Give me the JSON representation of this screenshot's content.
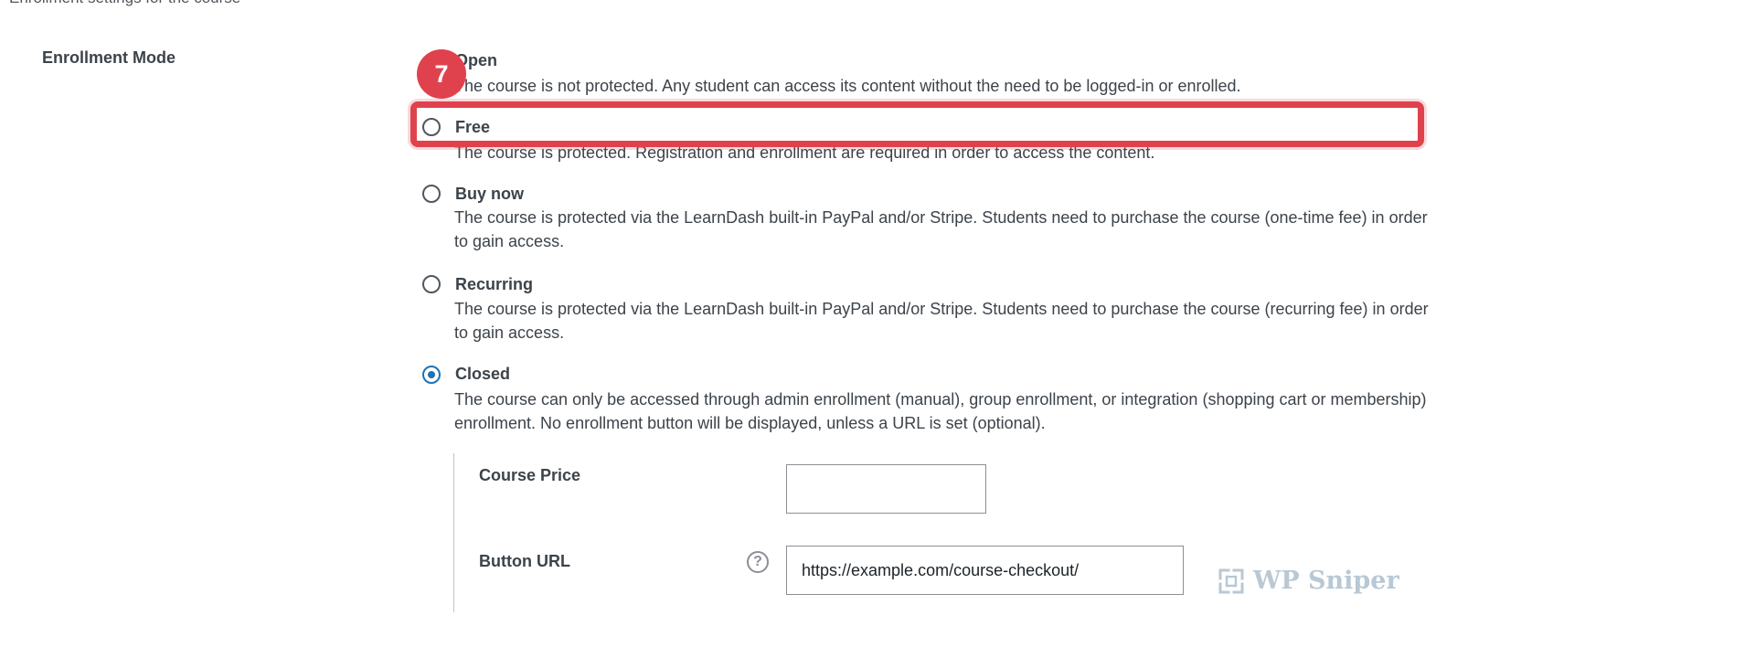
{
  "top_text": "Enrollment settings for the course",
  "field_label": "Enrollment Mode",
  "step_badge": "7",
  "options": [
    {
      "title": "Open",
      "description": "The course is not protected. Any student can access its content without the need to be logged-in or enrolled.",
      "checked": false
    },
    {
      "title": "Free",
      "description": "The course is protected. Registration and enrollment are required in order to access the content.",
      "checked": false
    },
    {
      "title": "Buy now",
      "description": "The course is protected via the LearnDash built-in PayPal and/or Stripe. Students need to purchase the course (one-time fee) in order to gain access.",
      "checked": false
    },
    {
      "title": "Recurring",
      "description": "The course is protected via the LearnDash built-in PayPal and/or Stripe. Students need to purchase the course (recurring fee) in order to gain access.",
      "checked": false
    },
    {
      "title": "Closed",
      "description": "The course can only be accessed through admin enrollment (manual), group enrollment, or integration (shopping cart or membership) enrollment. No enrollment button will be displayed, unless a URL is set (optional).",
      "checked": true
    }
  ],
  "course_price": {
    "label": "Course Price",
    "value": ""
  },
  "button_url": {
    "label": "Button URL",
    "value": "https://example.com/course-checkout/",
    "help_icon": "question-circle-icon"
  },
  "watermark": "WP Sniper",
  "colors": {
    "accent": "#2271b1",
    "highlight": "#e0424d"
  }
}
